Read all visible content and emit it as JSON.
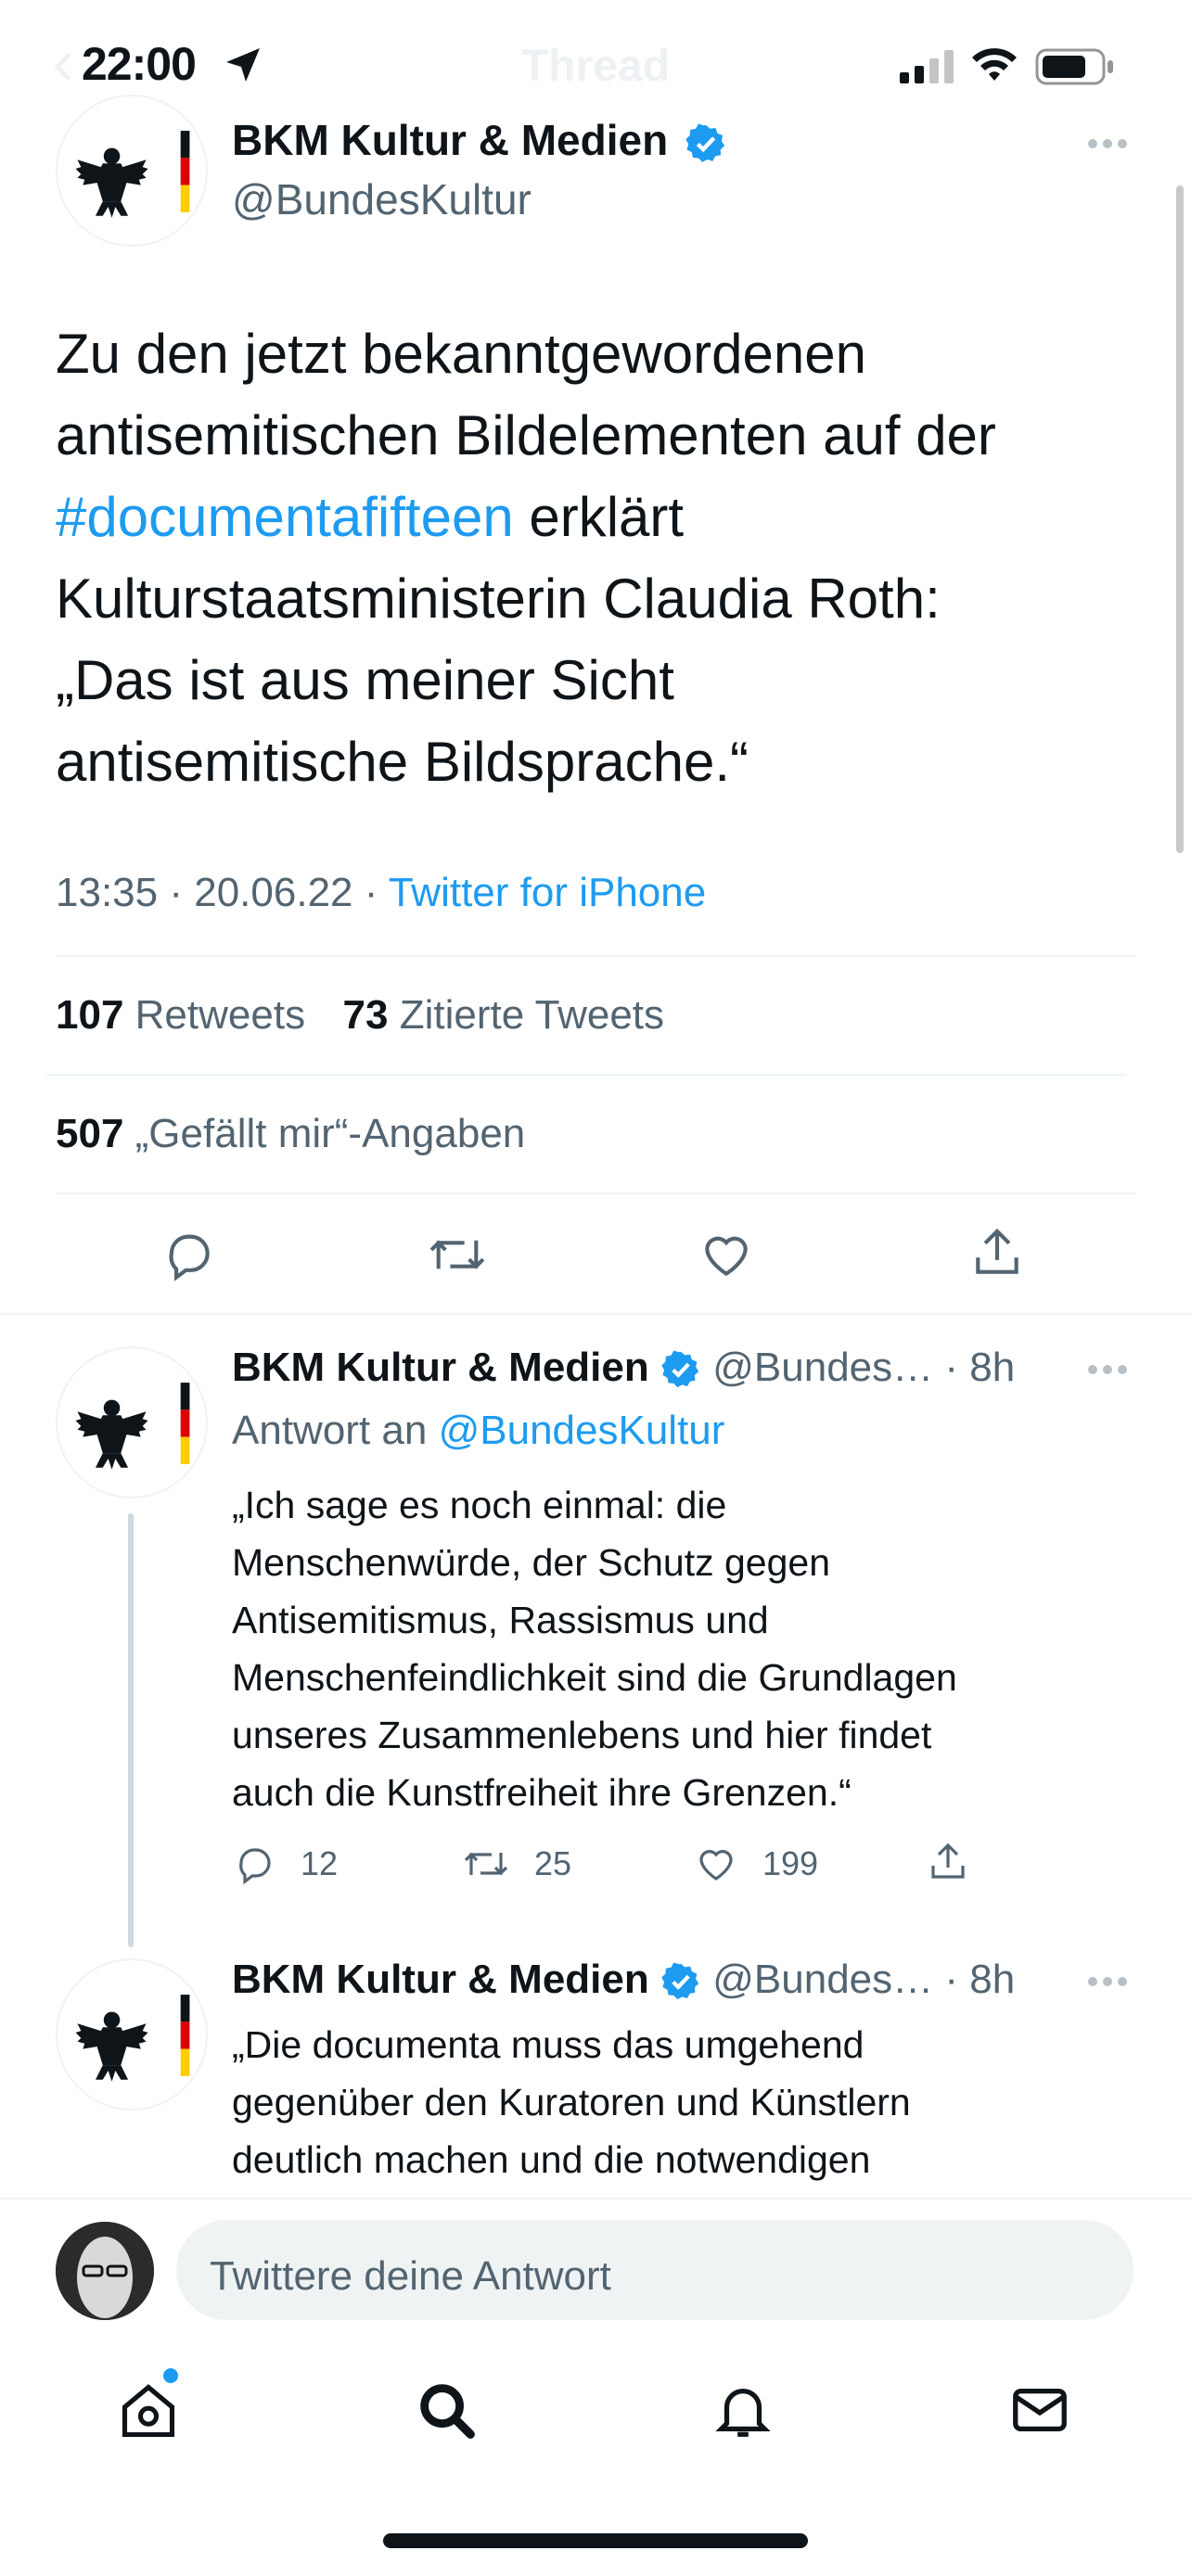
{
  "status_bar": {
    "time": "22:00"
  },
  "header": {
    "title": "Thread"
  },
  "main_tweet": {
    "author": {
      "name": "BKM Kultur & Medien",
      "handle": "@BundesKultur"
    },
    "text_lines": {
      "l1": "Zu den jetzt bekanntgewordenen",
      "l2": "antisemitischen Bildelementen auf der",
      "hashtag": "#documentafifteen",
      "l3_rest": " erklärt",
      "l4": "Kulturstaatsministerin Claudia Roth:",
      "l5": "„Das ist aus meiner Sicht",
      "l6": "antisemitische Bildsprache.“"
    },
    "meta": {
      "time": "13:35",
      "date": "20.06.22",
      "sep": "·",
      "source": "Twitter for iPhone"
    },
    "stats": {
      "retweets_count": "107",
      "retweets_label": "Retweets",
      "quotes_count": "73",
      "quotes_label": "Zitierte Tweets",
      "likes_count": "507",
      "likes_label": "„Gefällt mir“-Angaben"
    }
  },
  "replies": [
    {
      "name": "BKM Kultur & Medien",
      "handle": "@Bundes…",
      "time": "· 8h",
      "reply_to_label": "Antwort an",
      "reply_to_handle": "@BundesKultur",
      "text_lines": [
        "„Ich sage es noch einmal: die",
        "Menschenwürde, der Schutz gegen",
        "Antisemitismus, Rassismus und",
        "Menschenfeindlichkeit sind die Grundlagen",
        "unseres Zusammenlebens und hier findet",
        "auch die Kunstfreiheit ihre Grenzen.“"
      ],
      "reply_count": "12",
      "retweet_count": "25",
      "like_count": "199"
    },
    {
      "name": "BKM Kultur & Medien",
      "handle": "@Bundes…",
      "time": "· 8h",
      "text_lines": [
        "„Die documenta muss das umgehend",
        "gegenüber den Kuratoren und Künstlern",
        "deutlich machen und die notwendigen"
      ]
    }
  ],
  "composer": {
    "placeholder": "Twittere deine Antwort"
  },
  "tabbar": {
    "items": [
      "home",
      "search",
      "notifications",
      "messages"
    ]
  },
  "colors": {
    "accent": "#1d9bf0",
    "text": "#0f1419",
    "muted": "#536471",
    "divider": "#eff3f4"
  }
}
